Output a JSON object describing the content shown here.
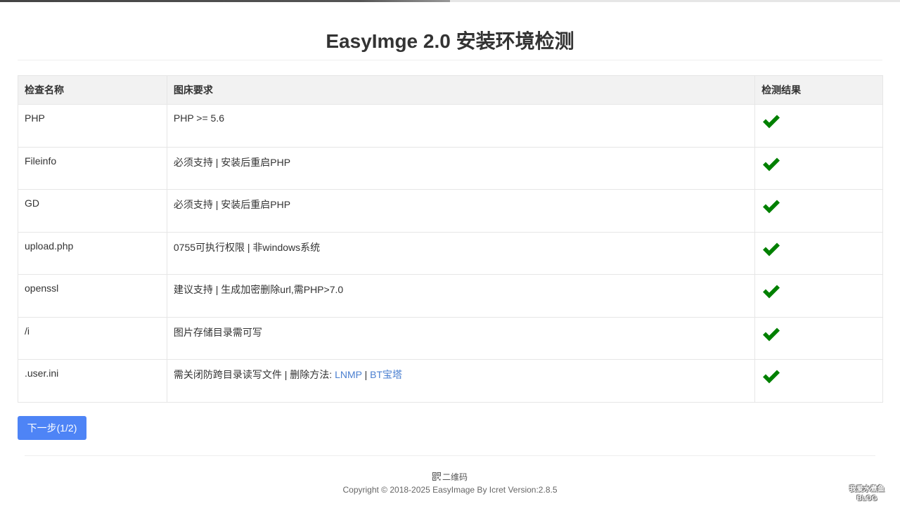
{
  "page": {
    "title": "EasyImge 2.0 安装环境检测"
  },
  "table": {
    "headers": [
      "检查名称",
      "图床要求",
      "检测结果"
    ],
    "rows": [
      {
        "name": "PHP",
        "requirement": "PHP >= 5.6",
        "status": "pass"
      },
      {
        "name": "Fileinfo",
        "requirement": "必须支持 | 安装后重启PHP",
        "status": "pass"
      },
      {
        "name": "GD",
        "requirement": "必须支持 | 安装后重启PHP",
        "status": "pass"
      },
      {
        "name": "upload.php",
        "requirement": "0755可执行权限 | 非windows系统",
        "status": "pass"
      },
      {
        "name": "openssl",
        "requirement": "建议支持 | 生成加密删除url,需PHP>7.0",
        "status": "pass"
      },
      {
        "name": "/i",
        "requirement": "图片存储目录需可写",
        "status": "pass"
      },
      {
        "name": ".user.ini",
        "requirement_prefix": "需关闭防跨目录读写文件 | 删除方法: ",
        "link1": "LNMP",
        "separator": " | ",
        "link2": "BT宝塔",
        "status": "pass"
      }
    ],
    "pass_icon": "checkmark-icon",
    "pass_color": "#008000"
  },
  "actions": {
    "next_label": "下一步(1/2)"
  },
  "footer": {
    "qr_icon": "qrcode-icon",
    "qr_label": "二维码",
    "copyright": "Copyright © 2018-2025 EasyImage By Icret Version:2.8.5",
    "watermark_line1": "我爱水煮鱼",
    "watermark_line2": "BLOG"
  },
  "colors": {
    "primary": "#4e84f6",
    "link": "#4a7fd0",
    "success": "#008000",
    "header_bg": "#f2f2f2",
    "border": "#e6e6e6"
  }
}
